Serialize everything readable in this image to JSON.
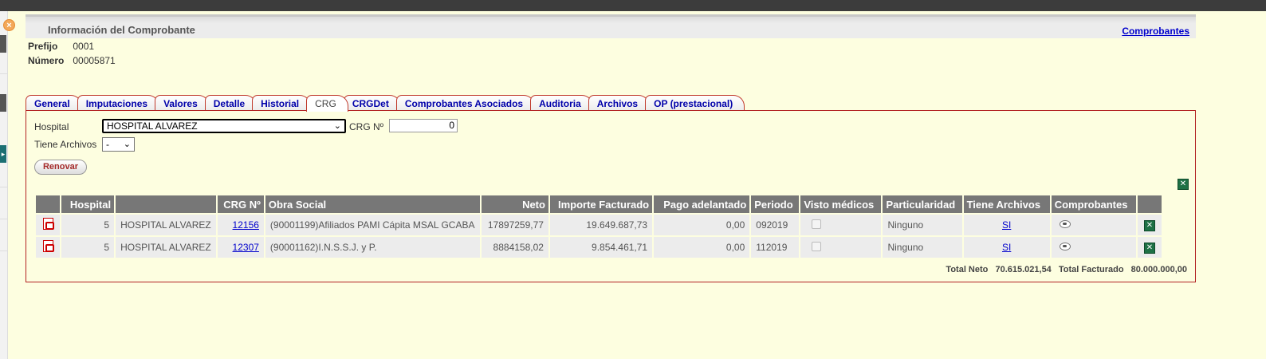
{
  "panel": {
    "title": "Información del Comprobante",
    "link": "Comprobantes",
    "prefijo_label": "Prefijo",
    "prefijo_value": "0001",
    "numero_label": "Número",
    "numero_value": "00005871"
  },
  "tabs": [
    {
      "label": "General",
      "active": false
    },
    {
      "label": "Imputaciones",
      "active": false
    },
    {
      "label": "Valores",
      "active": false
    },
    {
      "label": "Detalle",
      "active": false
    },
    {
      "label": "Historial",
      "active": false
    },
    {
      "label": "CRG",
      "active": true
    },
    {
      "label": "CRGDet",
      "active": false
    },
    {
      "label": "Comprobantes Asociados",
      "active": false
    },
    {
      "label": "Auditoria",
      "active": false
    },
    {
      "label": "Archivos",
      "active": false
    },
    {
      "label": "OP (prestacional)",
      "active": false
    }
  ],
  "filters": {
    "hospital_label": "Hospital",
    "hospital_value": "HOSPITAL ALVAREZ",
    "crg_label": "CRG Nº",
    "crg_value": "0",
    "archivos_label": "Tiene Archivos",
    "archivos_value": "-",
    "renovar": "Renovar"
  },
  "table": {
    "headers": [
      "",
      "Hospital",
      "",
      "CRG Nº",
      "Obra Social",
      "Neto",
      "Importe Facturado",
      "Pago adelantado",
      "Periodo",
      "Visto médicos",
      "Particularidad",
      "Tiene Archivos",
      "Comprobantes",
      ""
    ],
    "rows": [
      {
        "hosp_id": "5",
        "hosp_name": "HOSPITAL ALVAREZ",
        "crg": "12156",
        "obra": "(90001199)Afiliados PAMI Cápita MSAL GCABA",
        "neto": "17897259,77",
        "importe": "19.649.687,73",
        "pago": "0,00",
        "periodo": "092019",
        "particularidad": "Ninguno",
        "archivos": "SI"
      },
      {
        "hosp_id": "5",
        "hosp_name": "HOSPITAL ALVAREZ",
        "crg": "12307",
        "obra": "(90001162)I.N.S.S.J. y P.",
        "neto": "8884158,02",
        "importe": "9.854.461,71",
        "pago": "0,00",
        "periodo": "112019",
        "particularidad": "Ninguno",
        "archivos": "SI"
      }
    ]
  },
  "totals": {
    "neto_label": "Total Neto",
    "neto_value": "70.615.021,54",
    "fact_label": "Total Facturado",
    "fact_value": "80.000.000,00"
  },
  "icons": {
    "close": "close-icon",
    "pdf": "pdf-icon",
    "excel": "excel-icon",
    "view": "view-icon"
  },
  "colors": {
    "background": "#fdfee0",
    "accent_border": "#b22222",
    "link": "#0000cc",
    "header_grey": "#777777"
  }
}
